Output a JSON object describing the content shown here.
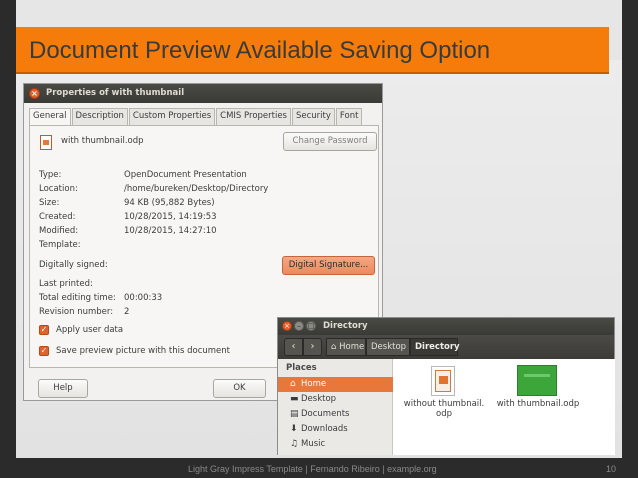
{
  "slide": {
    "title": "Document Preview Available Saving Option",
    "footer": "Light Gray Impress Template | Fernando Ribeiro | example.org",
    "page_number": "10"
  },
  "properties_dialog": {
    "title": "Properties of with thumbnail",
    "tabs": [
      "General",
      "Description",
      "Custom Properties",
      "CMIS Properties",
      "Security",
      "Font"
    ],
    "file_name": "with thumbnail.odp",
    "change_password": "Change Password",
    "fields": [
      {
        "label": "Type:",
        "value": "OpenDocument Presentation"
      },
      {
        "label": "Location:",
        "value": "/home/bureken/Desktop/Directory"
      },
      {
        "label": "Size:",
        "value": "94 KB (95,882 Bytes)"
      },
      {
        "label": "Created:",
        "value": "10/28/2015, 14:19:53"
      },
      {
        "label": "Modified:",
        "value": "10/28/2015, 14:27:10"
      },
      {
        "label": "Template:",
        "value": ""
      }
    ],
    "digitally_signed": "Digitally signed:",
    "digital_signature": "Digital Signature...",
    "fields2": [
      {
        "label": "Last printed:",
        "value": ""
      },
      {
        "label": "Total editing time:",
        "value": "00:00:33"
      },
      {
        "label": "Revision number:",
        "value": "2"
      }
    ],
    "apply_user_data": "Apply user data",
    "save_preview": "Save preview picture with this document",
    "help": "Help",
    "ok": "OK"
  },
  "directory_window": {
    "title": "Directory",
    "breadcrumbs": [
      "Home",
      "Desktop",
      "Directory"
    ],
    "places_header": "Places",
    "places": [
      "Home",
      "Desktop",
      "Documents",
      "Downloads",
      "Music"
    ],
    "files": [
      "without thumbnail.\nodp",
      "with thumbnail.odp"
    ],
    "colors": {
      "selection": "#e8773b",
      "title_accent": "#f57c0b"
    }
  }
}
